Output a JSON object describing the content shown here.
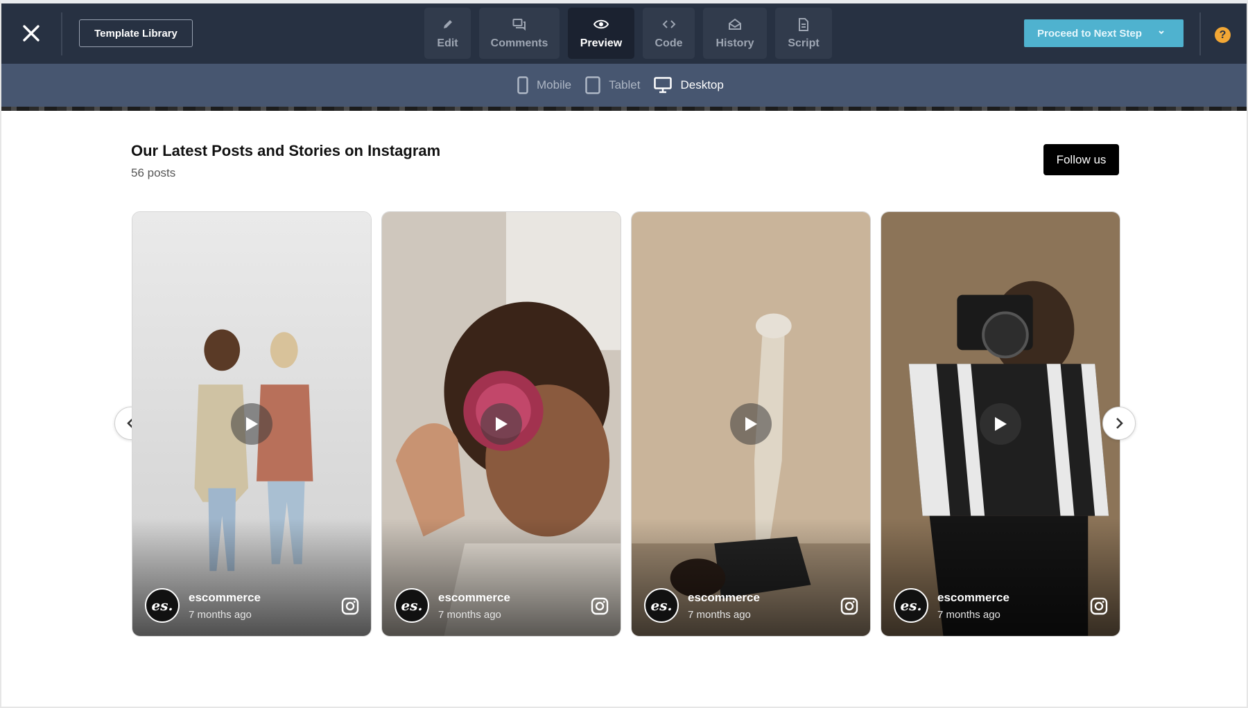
{
  "toolbar": {
    "close_icon": "close-icon",
    "template_library_label": "Template Library",
    "tabs": [
      {
        "label": "Edit",
        "icon": "pencil-icon"
      },
      {
        "label": "Comments",
        "icon": "comments-icon"
      },
      {
        "label": "Preview",
        "icon": "eye-icon",
        "active": true
      },
      {
        "label": "Code",
        "icon": "code-icon"
      },
      {
        "label": "History",
        "icon": "history-icon"
      },
      {
        "label": "Script",
        "icon": "script-icon"
      }
    ],
    "proceed_label": "Proceed to Next Step",
    "help_label": "?"
  },
  "devices": [
    {
      "label": "Mobile",
      "icon": "mobile-icon"
    },
    {
      "label": "Tablet",
      "icon": "tablet-icon"
    },
    {
      "label": "Desktop",
      "icon": "desktop-icon",
      "active": true
    }
  ],
  "section": {
    "title": "Our Latest Posts and Stories on Instagram",
    "post_count": "56 posts",
    "follow_label": "Follow us"
  },
  "posts": [
    {
      "username": "escommerce",
      "time": "7 months ago",
      "avatar_text": "es."
    },
    {
      "username": "escommerce",
      "time": "7 months ago",
      "avatar_text": "es."
    },
    {
      "username": "escommerce",
      "time": "7 months ago",
      "avatar_text": "es."
    },
    {
      "username": "escommerce",
      "time": "7 months ago",
      "avatar_text": "es."
    }
  ],
  "colors": {
    "toolbar_bg": "#273142",
    "device_bar_bg": "#475670",
    "accent": "#4fb2cf",
    "help": "#f2a735"
  }
}
